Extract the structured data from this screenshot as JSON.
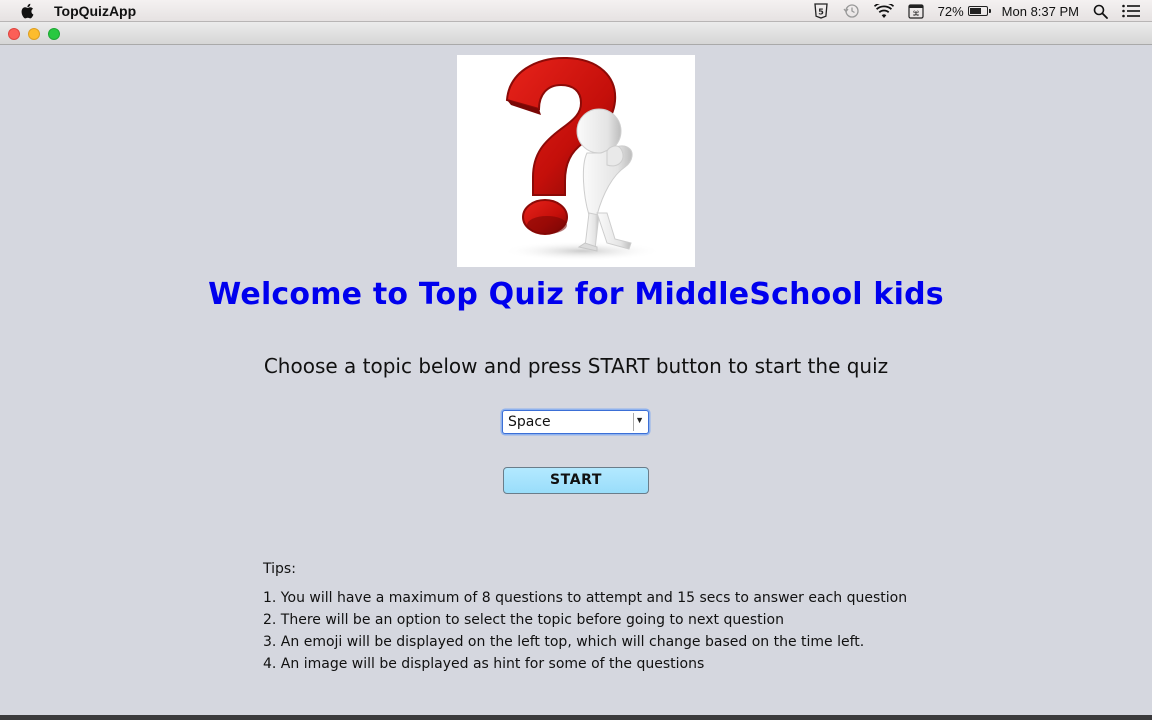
{
  "menubar": {
    "app_name": "TopQuizApp",
    "battery_text": "72%",
    "battery_level": 0.72,
    "clock": "Mon 8:37 PM",
    "icons": [
      "apple-icon",
      "html5-icon",
      "time-machine-icon",
      "wifi-icon",
      "keyboard-input-icon",
      "battery-icon",
      "spotlight-search-icon",
      "notification-center-icon"
    ]
  },
  "window": {
    "controls": [
      "close",
      "minimize",
      "maximize"
    ]
  },
  "main": {
    "hero_image": "question-mark-thinking-figure",
    "welcome_title": "Welcome to Top Quiz for MiddleSchool kids",
    "instructions": "Choose a topic below and press START button to start the quiz",
    "topic_select": {
      "value": "Space"
    },
    "start_label": "START",
    "tips": {
      "title": "Tips:",
      "items": [
        "1. You will have a maximum of 8 questions to attempt and 15 secs to answer each question",
        "2. There will be an option to select the topic before going to next question",
        "3. An emoji will be displayed on the left top, which will change based on the time left.",
        "4. An image will be displayed as hint for some of the questions"
      ]
    }
  },
  "colors": {
    "background": "#d5d7df",
    "title_blue": "#0000ee",
    "start_button": "#a6e3fc",
    "question_red": "#c8120c"
  }
}
